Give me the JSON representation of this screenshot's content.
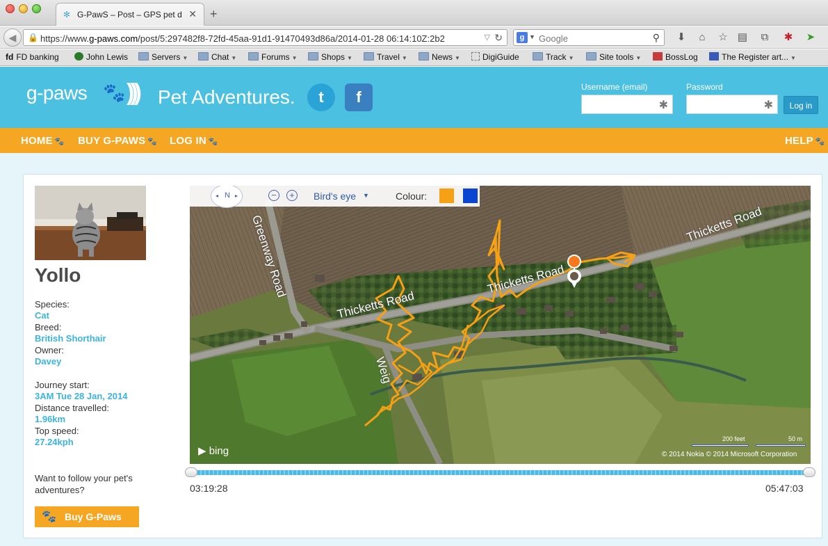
{
  "browser": {
    "tab_title": "G-PawS – Post – GPS pet d...",
    "url_prefix": "https://www.",
    "url_host": "g-paws.com",
    "url_rest": "/post/5:297482f8-72fd-45aa-91d1-91470493d86a/2014-01-28 06:14:10Z:2b2",
    "search_placeholder": "Google",
    "bookmarks": [
      {
        "label": "FD banking",
        "type": "site"
      },
      {
        "label": "John Lewis",
        "type": "site"
      },
      {
        "label": "Servers",
        "type": "folder"
      },
      {
        "label": "Chat",
        "type": "folder"
      },
      {
        "label": "Forums",
        "type": "folder"
      },
      {
        "label": "Shops",
        "type": "folder"
      },
      {
        "label": "Travel",
        "type": "folder"
      },
      {
        "label": "News",
        "type": "folder"
      },
      {
        "label": "DigiGuide",
        "type": "site"
      },
      {
        "label": "Track",
        "type": "folder"
      },
      {
        "label": "Site tools",
        "type": "folder"
      },
      {
        "label": "BossLog",
        "type": "site"
      },
      {
        "label": "The Register art...",
        "type": "site"
      }
    ]
  },
  "header": {
    "logo_text": "g-paws",
    "tagline": "Pet Adventures.",
    "username_label": "Username (email)",
    "password_label": "Password",
    "login_button": "Log in"
  },
  "nav": {
    "home": "HOME",
    "buy": "BUY G-PAWS",
    "login": "LOG IN",
    "help": "HELP"
  },
  "pet": {
    "name": "Yollo",
    "species_label": "Species:",
    "species": "Cat",
    "breed_label": "Breed:",
    "breed": "British Shorthair",
    "owner_label": "Owner:",
    "owner": "Davey",
    "journey_start_label": "Journey start:",
    "journey_start": "3AM Tue 28 Jan, 2014",
    "distance_label": "Distance travelled:",
    "distance": "1.96km",
    "top_speed_label": "Top speed:",
    "top_speed": "27.24kph"
  },
  "promo": {
    "text": "Want to follow your pet's adventures?",
    "button": "Buy G-Paws"
  },
  "map": {
    "view_mode": "Bird's eye",
    "colour_label": "Colour:",
    "colour_options": [
      "#f5a015",
      "#0a46d2"
    ],
    "compass_label": "N",
    "road_labels": [
      "Greenway Road",
      "Thicketts Road",
      "Thicketts Road",
      "Thicketts Road",
      "Weig"
    ],
    "brand": "bing",
    "copyright": "© 2014 Nokia    © 2014 Microsoft Corporation",
    "scale_feet": "200 feet",
    "scale_m": "50 m",
    "track_color": "#f5a015"
  },
  "timeline": {
    "start_time": "03:19:28",
    "end_time": "05:47:03"
  }
}
